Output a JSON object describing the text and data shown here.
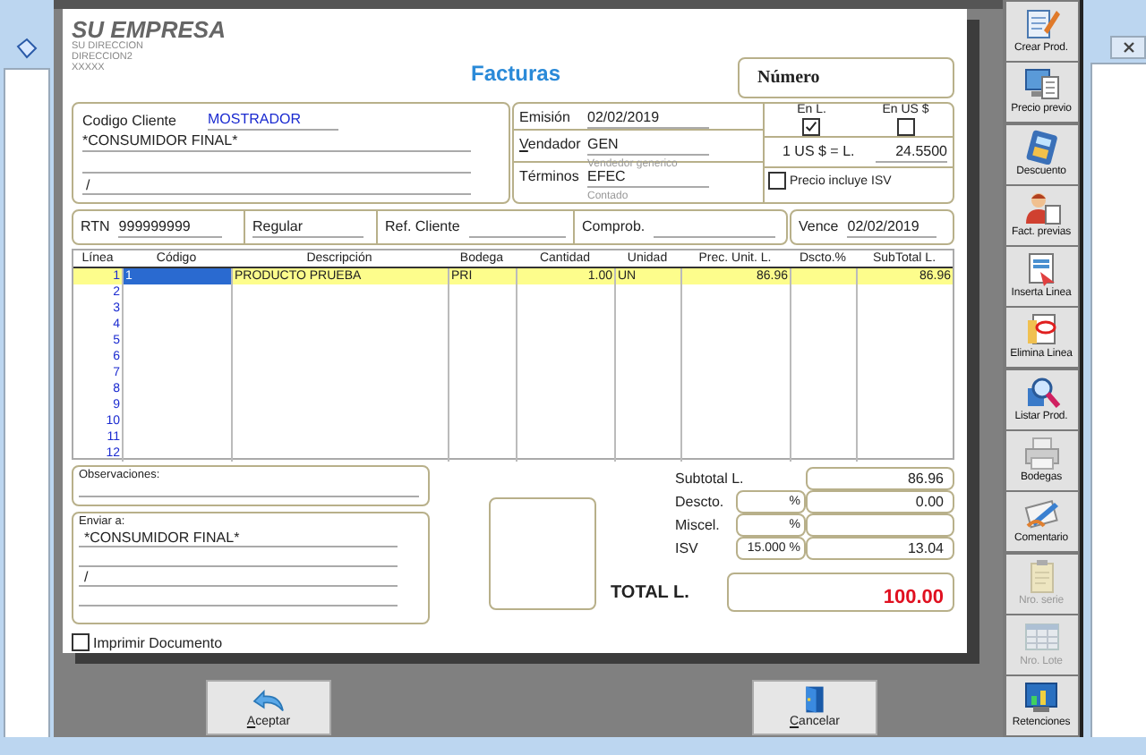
{
  "company": {
    "name": "SU EMPRESA",
    "address_lines": [
      "SU DIRECCION",
      "DIRECCION2",
      "XXXXX"
    ]
  },
  "document_title": "Facturas",
  "number": {
    "label": "Número"
  },
  "client": {
    "code_label": "Codigo Cliente",
    "code": "MOSTRADOR",
    "name": "*CONSUMIDOR FINAL*",
    "address": "/"
  },
  "header": {
    "emision": {
      "label": "Emisión",
      "value": "02/02/2019"
    },
    "vendedor": {
      "label": "Vendador",
      "value": "GEN",
      "note": "Vendedor generico"
    },
    "terminos": {
      "label": "Términos",
      "value": "EFEC",
      "note": "Contado"
    }
  },
  "currency": {
    "local": {
      "label": "En L.",
      "checked": true
    },
    "usd": {
      "label": "En US $",
      "checked": false
    },
    "rate_label": "1 US $ = L.",
    "rate": "24.5500",
    "price_includes_tax": {
      "label": "Precio incluye ISV",
      "checked": false
    }
  },
  "info_row": {
    "rtn_label": "RTN",
    "rtn": "999999999",
    "type": "Regular",
    "ref_label": "Ref. Cliente",
    "comprob_label": "Comprob.",
    "vence_label": "Vence",
    "vence": "02/02/2019"
  },
  "table": {
    "columns": [
      "Línea",
      "Código",
      "Descripción",
      "Bodega",
      "Cantidad",
      "Unidad",
      "Prec. Unit. L.",
      "Dscto.%",
      "SubTotal L."
    ],
    "rows": [
      {
        "line": "1",
        "code": "1",
        "description": "PRODUCTO PRUEBA",
        "warehouse": "PRI",
        "quantity": "1.00",
        "unit": "UN",
        "unit_price": "86.96",
        "subtotal": "86.96",
        "selected": true
      },
      {
        "line": "2",
        "selected": false
      },
      {
        "line": "3",
        "selected": false
      },
      {
        "line": "4",
        "selected": false
      },
      {
        "line": "5",
        "selected": false
      },
      {
        "line": "6",
        "selected": false
      },
      {
        "line": "7",
        "selected": false
      },
      {
        "line": "8",
        "selected": false
      },
      {
        "line": "9",
        "selected": false
      },
      {
        "line": "10",
        "selected": false
      },
      {
        "line": "11",
        "selected": false
      },
      {
        "line": "12",
        "selected": false
      }
    ]
  },
  "observaciones": {
    "label": "Observaciones:"
  },
  "enviar_a": {
    "label": "Enviar a:",
    "name": "*CONSUMIDOR FINAL*",
    "address": "/"
  },
  "print": {
    "label": "Imprimir Documento",
    "checked": false
  },
  "totals": {
    "rows": [
      {
        "label": "Subtotal L.",
        "value": "86.96"
      },
      {
        "label": "Descto.",
        "percent": "%",
        "value": "0.00"
      },
      {
        "label": "Miscel.",
        "percent": "%"
      },
      {
        "label": "ISV",
        "percent": "15.000 %",
        "value": "13.04"
      }
    ],
    "total_label": "TOTAL L.",
    "total": "100.00"
  },
  "actions": [
    {
      "label": "Aceptar",
      "kind": "accept"
    },
    {
      "label": "Cancelar",
      "kind": "cancel"
    }
  ],
  "toolbar": [
    {
      "label": "Crear Prod.",
      "kind": "create",
      "disabled": false
    },
    {
      "label": "Precio previo",
      "kind": "price",
      "disabled": false
    },
    {
      "label": "Descuento",
      "kind": "discount",
      "disabled": false
    },
    {
      "label": "Fact. previas",
      "kind": "history",
      "disabled": false
    },
    {
      "label": "Inserta Linea",
      "kind": "insert",
      "disabled": false
    },
    {
      "label": "Elimina Linea",
      "kind": "delete",
      "disabled": false
    },
    {
      "label": "Listar Prod.",
      "kind": "search",
      "disabled": false
    },
    {
      "label": "Bodegas",
      "kind": "warehouse",
      "disabled": false
    },
    {
      "label": "Comentario",
      "kind": "comment",
      "disabled": false
    },
    {
      "label": "Nro. serie",
      "kind": "serial",
      "disabled": true
    },
    {
      "label": "Nro. Lote",
      "kind": "lot",
      "disabled": true
    },
    {
      "label": "Retenciones",
      "kind": "retention",
      "disabled": false
    }
  ]
}
